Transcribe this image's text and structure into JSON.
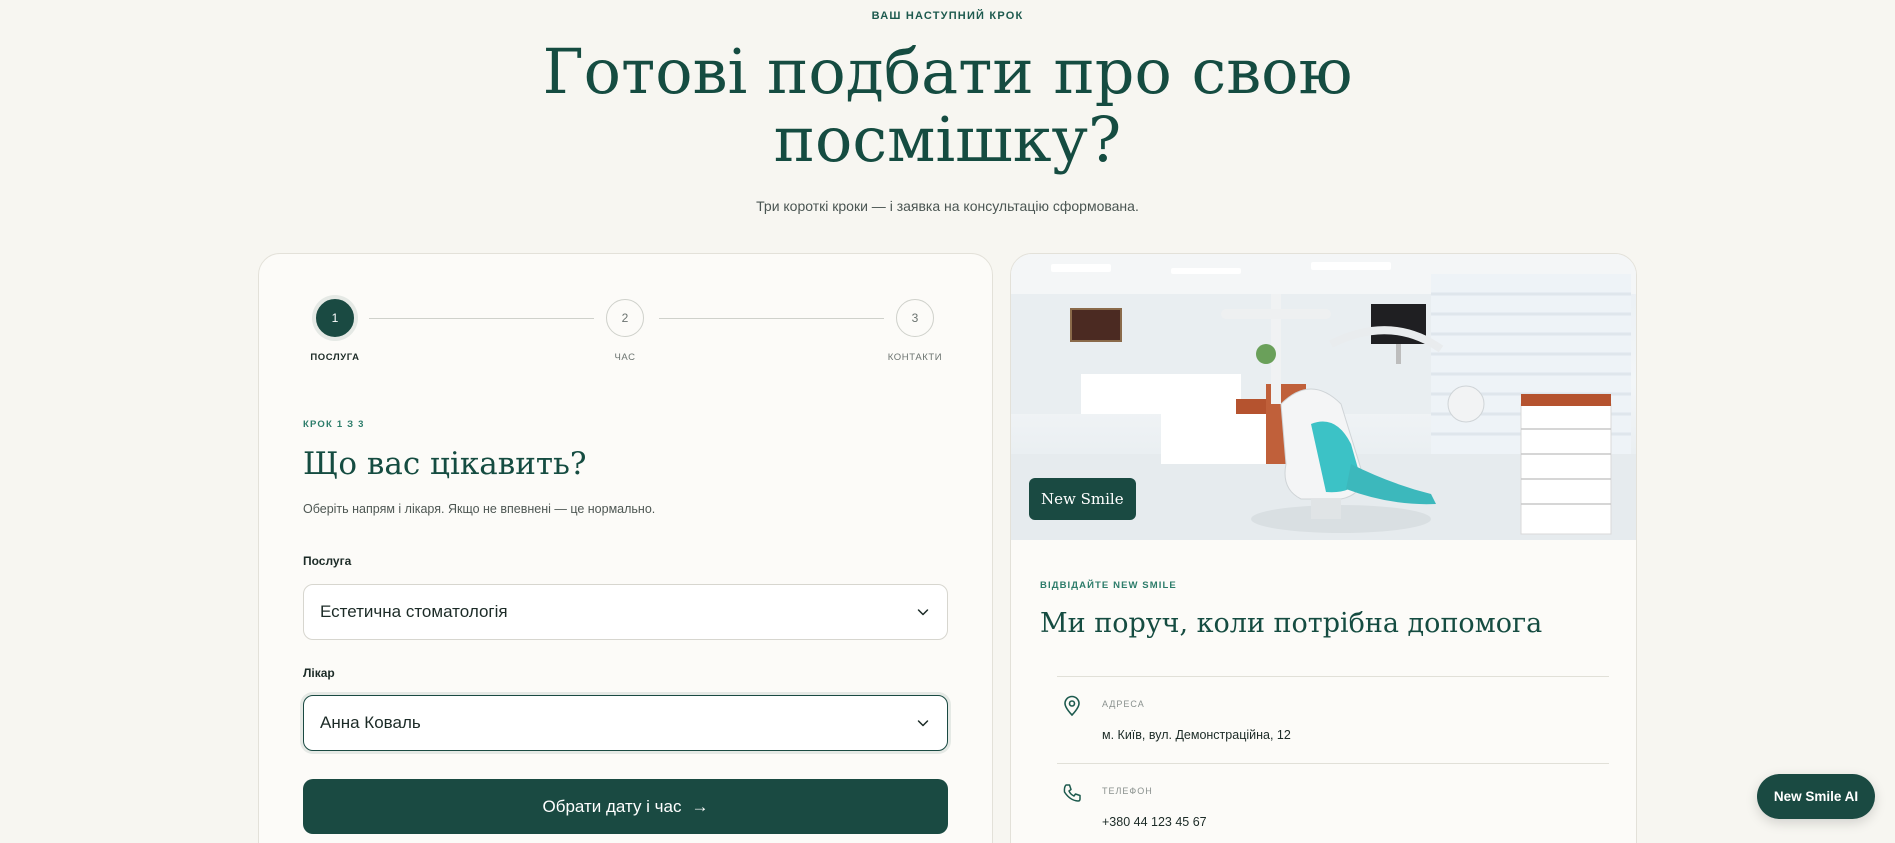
{
  "hero": {
    "eyebrow": "ВАШ НАСТУПНИЙ КРОК",
    "title_line1": "Готові подбати про свою",
    "title_line2": "посмішку?",
    "subtitle": "Три короткі кроки — і заявка на консультацію сформована."
  },
  "stepper": {
    "steps": [
      {
        "number": "1",
        "label": "ПОСЛУГА",
        "active": true
      },
      {
        "number": "2",
        "label": "ЧАС",
        "active": false
      },
      {
        "number": "3",
        "label": "КОНТАКТИ",
        "active": false
      }
    ]
  },
  "form": {
    "kicker": "КРОК 1 З 3",
    "title": "Що вас цікавить?",
    "description": "Оберіть напрям і лікаря. Якщо не впевнені — це нормально.",
    "service_label": "Послуга",
    "service_value": "Естетична стоматологія",
    "doctor_label": "Лікар",
    "doctor_value": "Анна Коваль",
    "cta_label": "Обрати дату і час",
    "cta_arrow": "→"
  },
  "info": {
    "photo_badge": "New Smile",
    "kicker": "ВІДВІДАЙТЕ NEW SMILE",
    "title": "Ми поруч, коли потрібна допомога",
    "address_label": "АДРЕСА",
    "address_value": "м. Київ, вул. Демонстраційна, 12",
    "phone_label": "ТЕЛЕФОН",
    "phone_value": "+380 44 123 45 67"
  },
  "chat": {
    "label": "New Smile AI"
  },
  "colors": {
    "background": "#f7f6f1",
    "brand": "#1a4a42",
    "heading": "#154c41",
    "accent": "#2c7c6a"
  },
  "icons": {
    "select_chevron": "chevron-down-icon",
    "address": "map-pin-icon",
    "phone": "phone-icon"
  }
}
